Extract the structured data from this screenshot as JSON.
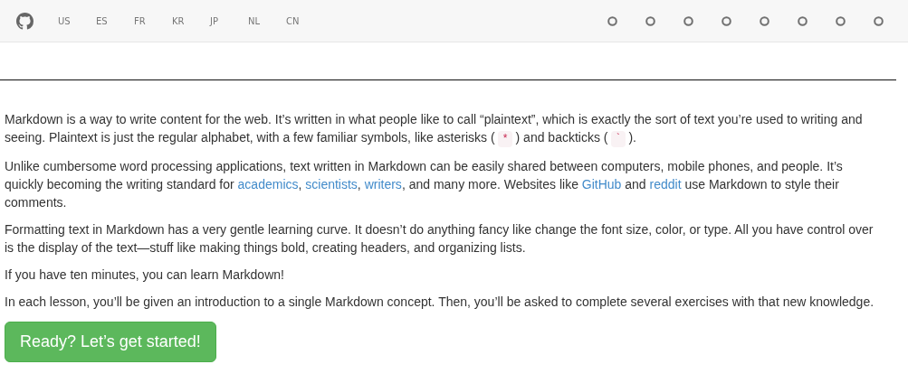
{
  "nav": {
    "languages": [
      "US",
      "ES",
      "FR",
      "KR",
      "JP",
      "NL",
      "CN"
    ],
    "lesson_dots": [
      {
        "selected": false
      },
      {
        "selected": false
      },
      {
        "selected": false
      },
      {
        "selected": false
      },
      {
        "selected": false
      },
      {
        "selected": false
      },
      {
        "selected": false
      },
      {
        "selected": false
      }
    ]
  },
  "paragraphs": [
    [
      {
        "kind": "text",
        "text": "Markdown is a way to write content for the web. It’s written in what people like to call “plaintext”, which is exactly the sort of text you’re used to writing and seeing. Plaintext is just the regular alphabet, with a few familiar symbols, like asterisks ( "
      },
      {
        "kind": "code",
        "text": "*"
      },
      {
        "kind": "text",
        "text": " ) and backticks ( "
      },
      {
        "kind": "code",
        "text": "`"
      },
      {
        "kind": "text",
        "text": " )."
      }
    ],
    [
      {
        "kind": "text",
        "text": "Unlike cumbersome word processing applications, text written in Markdown can be easily shared between computers, mobile phones, and people. It’s quickly becoming the writing standard for "
      },
      {
        "kind": "link",
        "text": "academics"
      },
      {
        "kind": "text",
        "text": ", "
      },
      {
        "kind": "link",
        "text": "scientists"
      },
      {
        "kind": "text",
        "text": ", "
      },
      {
        "kind": "link",
        "text": "writers"
      },
      {
        "kind": "text",
        "text": ", and many more. Websites like "
      },
      {
        "kind": "link",
        "text": "GitHub"
      },
      {
        "kind": "text",
        "text": " and "
      },
      {
        "kind": "link",
        "text": "reddit"
      },
      {
        "kind": "text",
        "text": " use Markdown to style their comments."
      }
    ],
    [
      {
        "kind": "text",
        "text": "Formatting text in Markdown has a very gentle learning curve. It doesn’t do anything fancy like change the font size, color, or type. All you have control over is the display of the text—stuff like making things bold, creating headers, and organizing lists."
      }
    ],
    [
      {
        "kind": "text",
        "text": "If you have ten minutes, you can learn Markdown!"
      }
    ],
    [
      {
        "kind": "text",
        "text": "In each lesson, you’ll be given an introduction to a single Markdown concept. Then, you’ll be asked to complete several exercises with that new knowledge."
      }
    ]
  ],
  "start_button": "Ready? Let’s get started!"
}
